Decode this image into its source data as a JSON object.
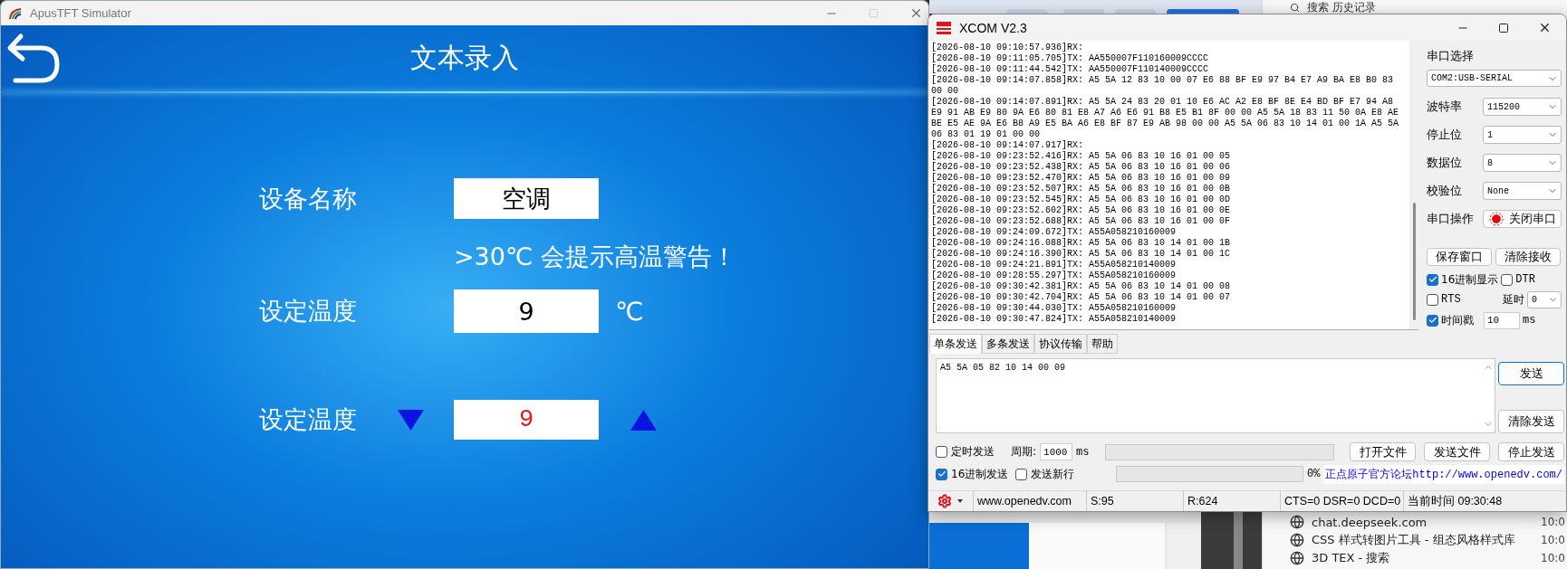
{
  "simulator": {
    "title": "ApusTFT Simulator",
    "screen_title": "文本录入",
    "fields": [
      {
        "kind": "text",
        "label": "设备名称",
        "value": "空调"
      },
      {
        "kind": "note",
        "text": ">30℃ 会提示高温警告！"
      },
      {
        "kind": "input",
        "label": "设定温度",
        "value": "9",
        "unit": "℃"
      },
      {
        "kind": "stepper",
        "label": "设定温度",
        "value": "9"
      }
    ]
  },
  "xcom": {
    "title": "XCOM V2.3",
    "log": [
      "[2026-08-10 09:10:57.936]RX:",
      "[2026-08-10 09:11:05.705]TX: AA550007F110160009CCCC",
      "[2026-08-10 09:11:44.542]TX: AA550007F110140009CCCC",
      "[2026-08-10 09:14:07.858]RX: A5 5A 12 83 10 00 07 E6 88 BF E9 97 B4 E7 A9 BA E8 B0 83 00 00",
      "[2026-08-10 09:14:07.891]RX: A5 5A 24 83 20 01 10 E6 AC A2 E8 BF 8E E4 BD BF E7 94 A8 E9 91 AB E9 80 9A E6 80 81 E8 A7 A6 E6 91 B8 E5 B1 8F 00 00 A5 5A 18 83 11 50 0A E8 AE BE E5 AE 9A E6 B8 A9 E5 BA A6 E8 BF 87 E9 AB 98 00 00 A5 5A 06 83 10 14 01 00 1A A5 5A 06 83 01 19 01 00 00",
      "[2026-08-10 09:14:07.917]RX:",
      "[2026-08-10 09:23:52.416]RX: A5 5A 06 83 10 16 01 00 05",
      "[2026-08-10 09:23:52.438]RX: A5 5A 06 83 10 16 01 00 06",
      "[2026-08-10 09:23:52.470]RX: A5 5A 06 83 10 16 01 00 09",
      "[2026-08-10 09:23:52.507]RX: A5 5A 06 83 10 16 01 00 0B",
      "[2026-08-10 09:23:52.545]RX: A5 5A 06 83 10 16 01 00 0D",
      "[2026-08-10 09:23:52.602]RX: A5 5A 06 83 10 16 01 00 0E",
      "[2026-08-10 09:23:52.688]RX: A5 5A 06 83 10 16 01 00 0F",
      "[2026-08-10 09:24:09.672]TX: A55A058210160009",
      "[2026-08-10 09:24:16.088]RX: A5 5A 06 83 10 14 01 00 1B",
      "[2026-08-10 09:24:16.390]RX: A5 5A 06 83 10 14 01 00 1C",
      "[2026-08-10 09:24:21.891]TX: A55A058210140009",
      "[2026-08-10 09:28:55.297]TX: A55A058210160009",
      "[2026-08-10 09:30:42.381]RX: A5 5A 06 83 10 14 01 00 08",
      "[2026-08-10 09:30:42.704]RX: A5 5A 06 83 10 14 01 00 07",
      "[2026-08-10 09:30:44.030]TX: A55A058210160009",
      "[2026-08-10 09:30:47.824]TX: A55A058210140009"
    ],
    "port": {
      "label": "串口选择",
      "value": "COM2:USB-SERIAL"
    },
    "settings": [
      {
        "label": "波特率",
        "value": "115200"
      },
      {
        "label": "停止位",
        "value": "1"
      },
      {
        "label": "数据位",
        "value": "8"
      },
      {
        "label": "校验位",
        "value": "None"
      }
    ],
    "port_operation": {
      "label": "串口操作",
      "button": "关闭串口",
      "open": true
    },
    "receive_buttons": [
      "保存窗口",
      "清除接收"
    ],
    "options": [
      {
        "label": "16进制显示",
        "checked": true
      },
      {
        "label": "DTR",
        "checked": false
      },
      {
        "label": "RTS",
        "checked": false
      }
    ],
    "delay": {
      "label": "延时",
      "value": "0"
    },
    "timestamp": {
      "label": "时间戳",
      "checked": true,
      "value": "10",
      "unit": "ms"
    },
    "tabs": [
      {
        "label": "单条发送",
        "selected": true
      },
      {
        "label": "多条发送",
        "selected": false
      },
      {
        "label": "协议传输",
        "selected": false
      },
      {
        "label": "帮助",
        "selected": false
      }
    ],
    "send_text": "A5 5A 05 82 10 14 00 09",
    "send_buttons": [
      {
        "label": "发送",
        "focused": true
      },
      {
        "label": "清除发送",
        "focused": false
      }
    ],
    "timer": {
      "label": "定时发送",
      "checked": false,
      "period_label": "周期:",
      "period": "1000",
      "unit": "ms"
    },
    "file_buttons": [
      "打开文件",
      "发送文件",
      "停止发送"
    ],
    "send_options": [
      {
        "label": "16进制发送",
        "checked": true
      },
      {
        "label": "发送新行",
        "checked": false
      }
    ],
    "progress": {
      "level": 0,
      "reading": "0%"
    },
    "link": "正点原子官方论坛http://www.openedv.com/",
    "status": [
      "www.openedv.com",
      "S:95",
      "R:624",
      "CTS=0 DSR=0 DCD=0",
      "当前时间 09:30:48"
    ]
  },
  "browser": {
    "search": "搜索 历史记录",
    "history": [
      {
        "title": "chat.deepseek.com",
        "time": "10:0"
      },
      {
        "title": "CSS 样式转图片工具 - 组态风格样式库",
        "time": "10:0"
      },
      {
        "title": "3D TEX - 搜索",
        "time": "10:0"
      }
    ]
  }
}
